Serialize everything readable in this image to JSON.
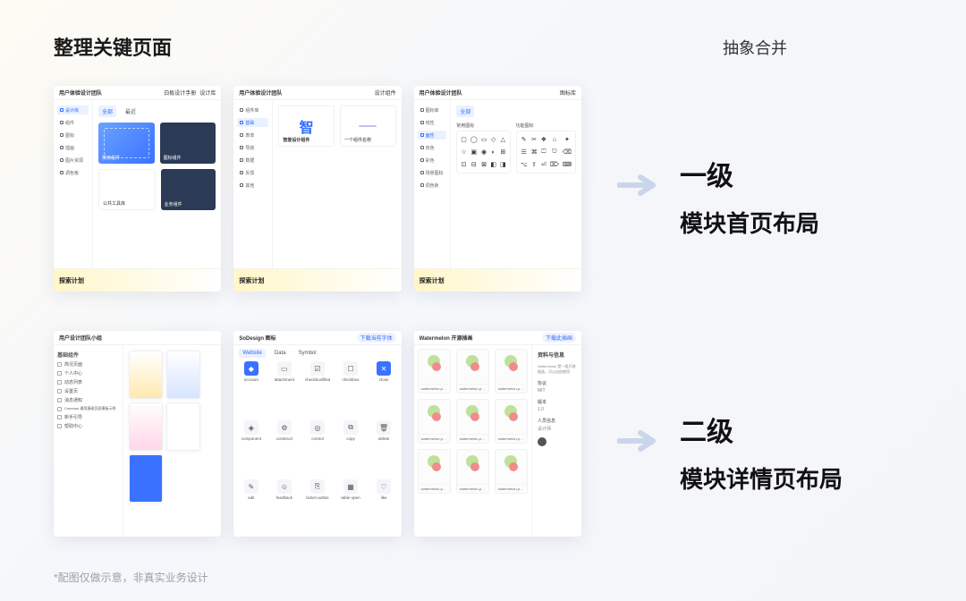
{
  "headings": {
    "left": "整理关键页面",
    "right": "抽象合并"
  },
  "row1": {
    "thumb1": {
      "crumb": "用户体验设计团队",
      "tab_a": "白板设计手册",
      "tab_b": "设计库",
      "nav_active": "设计库",
      "nav": [
        "设计库",
        "组件",
        "图标",
        "插画",
        "图片资源",
        "调色板"
      ],
      "tabs": [
        "全部",
        "最近"
      ],
      "cards": [
        "常用组件",
        "图标组件"
      ],
      "cards2": [
        "公共工具库",
        "业务组件"
      ],
      "footer": "探索计划"
    },
    "thumb2": {
      "crumb": "用户体验设计团队",
      "sub": "设计组件",
      "nav": [
        "组件库",
        "基础",
        "表单",
        "导航",
        "数据",
        "反馈",
        "其他"
      ],
      "nav_active": "基础",
      "card_a": "智",
      "card_a_label": "智能设计组件",
      "card_b_label": "一个组件名称",
      "footer": "探索计划"
    },
    "thumb3": {
      "crumb": "用户体验设计团队",
      "sub": "图标库",
      "nav": [
        "图标库",
        "线性",
        "面性",
        "双色",
        "彩色",
        "场景图标",
        "调色板"
      ],
      "nav_active": "面性",
      "tabs": [
        "全部"
      ],
      "group_a": "常用图标",
      "group_b": "功能图标",
      "footer": "探索计划"
    }
  },
  "row2": {
    "thumb1": {
      "crumb": "用户设计团队小组",
      "panel_title": "基础组件",
      "tree": [
        "简况页面",
        "个人中心",
        "动态列表",
        "设置页",
        "消息通知",
        "Common 通用基础页面模板示例",
        "新手引导",
        "帮助中心"
      ]
    },
    "thumb2": {
      "crumb": "SoDesign 图标",
      "chip": "下载当前字体",
      "tabs": [
        "Website",
        "Data",
        "Symbol"
      ],
      "items": [
        "account",
        "attachment",
        "checkboxfilled",
        "checkbox",
        "close",
        "component",
        "construct",
        "control",
        "copy",
        "delete",
        "edit",
        "feedback",
        "ticket-outline",
        "table-open",
        "like"
      ]
    },
    "thumb3": {
      "crumb": "Watermelon 开源插画",
      "chip": "下载此插画",
      "caption": "watermelon-pack-illustration-…",
      "right_title": "资料与信息",
      "right_desc": "Watermelon 是一组开源插画，可以自由使用",
      "right_k1": "协议",
      "right_v1": "MIT",
      "right_k2": "版本",
      "right_v2": "1.0",
      "right_k3": "人员信息",
      "right_v3": "设计师"
    }
  },
  "right_labels": {
    "level1_a": "一级",
    "level1_b": "模块首页布局",
    "level2_a": "二级",
    "level2_b": "模块详情页布局"
  },
  "footnote": "*配图仅做示意，非真实业务设计"
}
